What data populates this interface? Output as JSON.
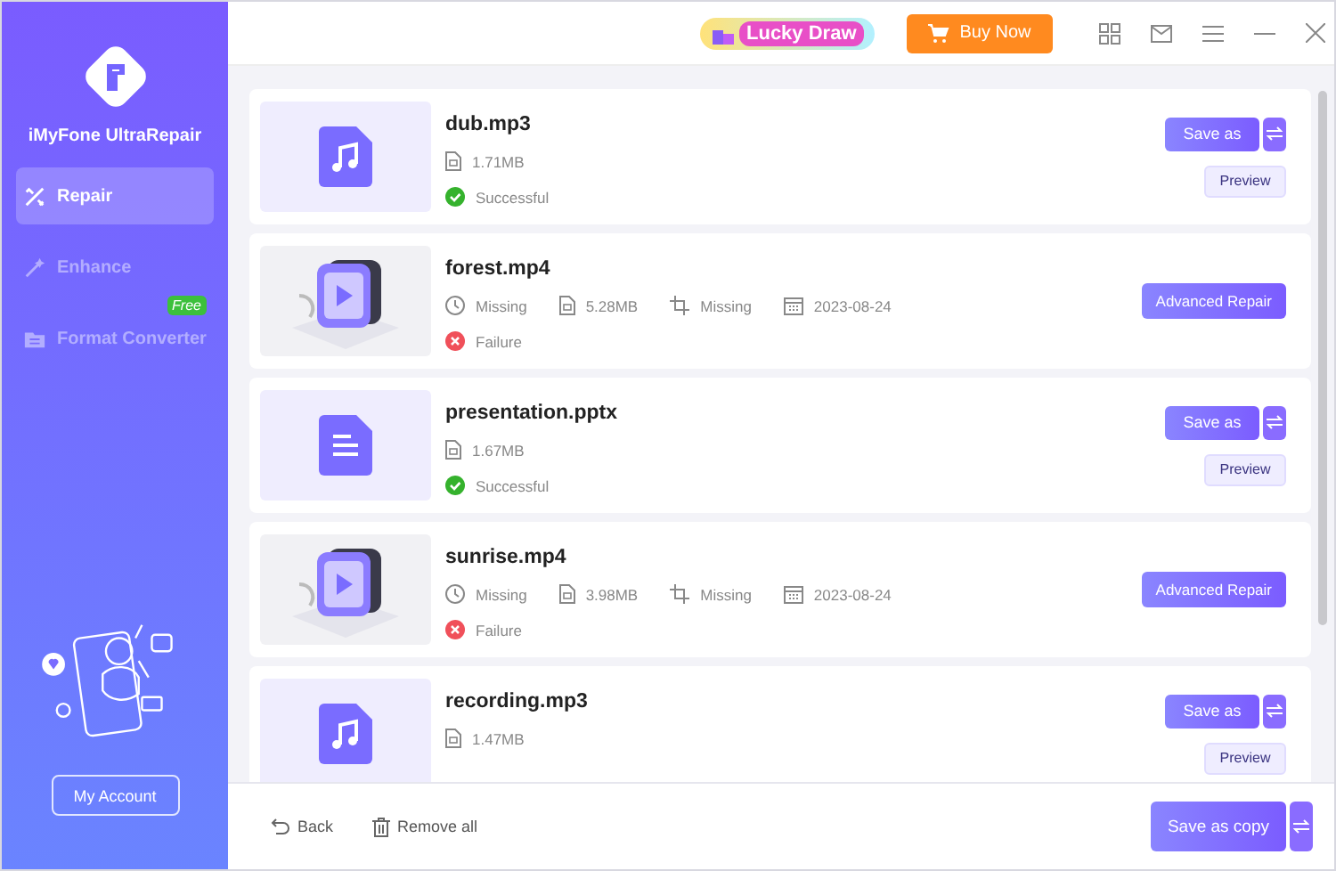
{
  "sidebar": {
    "app_name": "iMyFone UltraRepair",
    "items": [
      {
        "label": "Repair",
        "selected": true
      },
      {
        "label": "Enhance",
        "selected": false
      },
      {
        "label": "Format Converter",
        "selected": false,
        "badge": "Free"
      }
    ],
    "account_button": "My Account"
  },
  "topbar": {
    "promo": "Lucky Draw",
    "buy_button": "Buy Now"
  },
  "files": [
    {
      "name": "dub.mp3",
      "kind": "audio",
      "meta": [
        {
          "kind": "size",
          "text": "1.71MB"
        }
      ],
      "status": {
        "kind": "success",
        "text": "Successful"
      },
      "save_label": "Save as",
      "preview_label": "Preview"
    },
    {
      "name": "forest.mp4",
      "kind": "video",
      "meta": [
        {
          "kind": "duration",
          "text": "Missing"
        },
        {
          "kind": "size",
          "text": "5.28MB"
        },
        {
          "kind": "resolution",
          "text": "Missing"
        },
        {
          "kind": "date",
          "text": "2023-08-24"
        }
      ],
      "status": {
        "kind": "failure",
        "text": "Failure"
      },
      "advanced_label": "Advanced Repair"
    },
    {
      "name": "presentation.pptx",
      "kind": "document",
      "meta": [
        {
          "kind": "size",
          "text": "1.67MB"
        }
      ],
      "status": {
        "kind": "success",
        "text": "Successful"
      },
      "save_label": "Save as",
      "preview_label": "Preview"
    },
    {
      "name": "sunrise.mp4",
      "kind": "video",
      "meta": [
        {
          "kind": "duration",
          "text": "Missing"
        },
        {
          "kind": "size",
          "text": "3.98MB"
        },
        {
          "kind": "resolution",
          "text": "Missing"
        },
        {
          "kind": "date",
          "text": "2023-08-24"
        }
      ],
      "status": {
        "kind": "failure",
        "text": "Failure"
      },
      "advanced_label": "Advanced Repair"
    },
    {
      "name": "recording.mp3",
      "kind": "audio",
      "meta": [
        {
          "kind": "size",
          "text": "1.47MB"
        }
      ],
      "save_label": "Save as",
      "preview_label": "Preview"
    }
  ],
  "footer": {
    "back": "Back",
    "remove_all": "Remove all",
    "save_copy": "Save as copy"
  }
}
